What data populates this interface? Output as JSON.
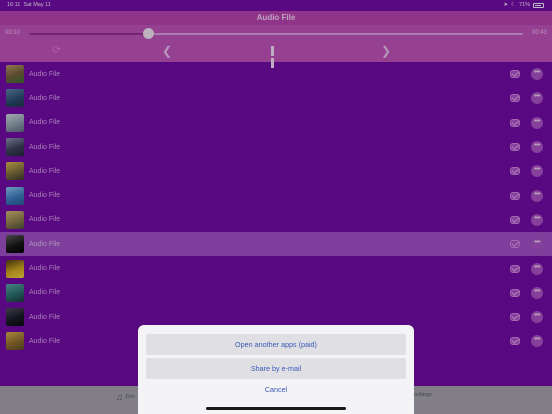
{
  "status_bar": {
    "time": "16:11",
    "date": "Sat May 11",
    "battery": "71%"
  },
  "header": {
    "title": "Audio File"
  },
  "player": {
    "elapsed": "00:10",
    "remaining": "00:43",
    "progress": 0.24
  },
  "tracks": [
    {
      "title": "Audio File",
      "colors": [
        "#6b5a3a",
        "#b49060",
        "#3b6e2a"
      ]
    },
    {
      "title": "Audio File",
      "colors": [
        "#2a4a6e",
        "#5a7ea0",
        "#1e3048"
      ]
    },
    {
      "title": "Audio File",
      "colors": [
        "#8a9aa8",
        "#c6d0d6",
        "#5a6a78"
      ]
    },
    {
      "title": "Audio File",
      "colors": [
        "#3a3e58",
        "#8b8aa8",
        "#202838"
      ]
    },
    {
      "title": "Audio File",
      "colors": [
        "#7a6a3a",
        "#d4b050",
        "#3a3a2a"
      ]
    },
    {
      "title": "Audio File",
      "colors": [
        "#3a78b8",
        "#8ac0e8",
        "#285890"
      ]
    },
    {
      "title": "Audio File",
      "colors": [
        "#8a7a4a",
        "#c8b070",
        "#4a4a3a"
      ]
    },
    {
      "title": "Audio File",
      "colors": [
        "#181818",
        "#5a5a5a",
        "#000000"
      ],
      "selected": true
    },
    {
      "title": "Audio File",
      "colors": [
        "#c8a020",
        "#4a3a10",
        "#e8c840"
      ]
    },
    {
      "title": "Audio File",
      "colors": [
        "#2a6a6a",
        "#58a0a0",
        "#1a3a3a"
      ]
    },
    {
      "title": "Audio File",
      "colors": [
        "#1a1a2a",
        "#4a4a5a",
        "#0a0a0a"
      ]
    },
    {
      "title": "Audio File",
      "colors": [
        "#8a6a2a",
        "#d0a850",
        "#5a4a2a"
      ]
    }
  ],
  "tab_bar": {
    "dropbox_label": "Dro",
    "settings_label": "Settings"
  },
  "action_sheet": {
    "option_1": "Open another apps (paid)",
    "option_2": "Share by e-mail",
    "cancel": "Cancel"
  },
  "icons": {
    "prev": "chevron-left-icon",
    "next": "chevron-right-icon",
    "pause": "pause-icon",
    "repeat": "repeat-icon",
    "mail": "mail-icon",
    "more": "more-icon"
  }
}
